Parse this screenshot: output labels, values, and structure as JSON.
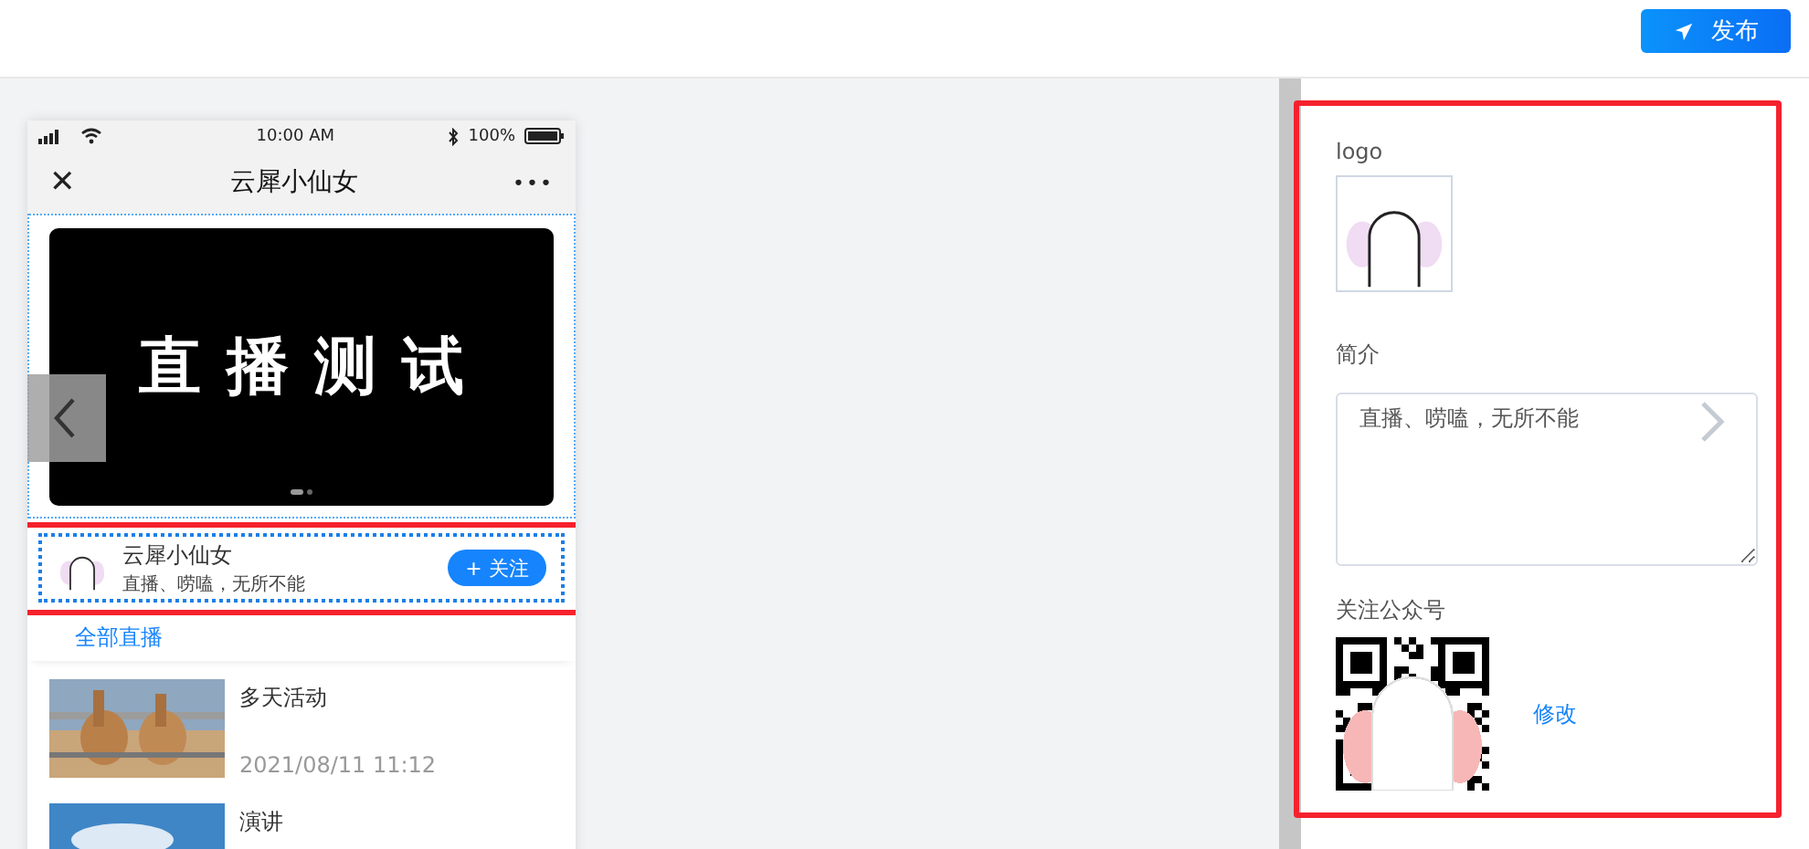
{
  "toolbar": {
    "publish_button": "发布"
  },
  "phone": {
    "status_bar": {
      "time": "10:00 AM",
      "battery": "100%"
    },
    "nav": {
      "title": "云犀小仙女",
      "close": "✕",
      "more": "•••"
    },
    "banner": {
      "title": "直播测试",
      "dots": [
        {
          "selected": true
        },
        {
          "selected": false
        }
      ]
    },
    "profile": {
      "name": "云犀小仙女",
      "bio": "直播、唠嗑，无所不能",
      "follow_button": "+ 关注"
    },
    "all_live_link": "全部直播",
    "lives": [
      {
        "title": "多天活动",
        "time": "2021/08/11 11:12",
        "kind": "picture"
      },
      {
        "title": "演讲",
        "kind": "picture"
      }
    ]
  },
  "settings": {
    "logo_label": "logo",
    "intro_label": "简介",
    "intro_value": "直播、唠嗑，无所不能",
    "account_label": "关注公众号",
    "edit_link": "修改"
  }
}
